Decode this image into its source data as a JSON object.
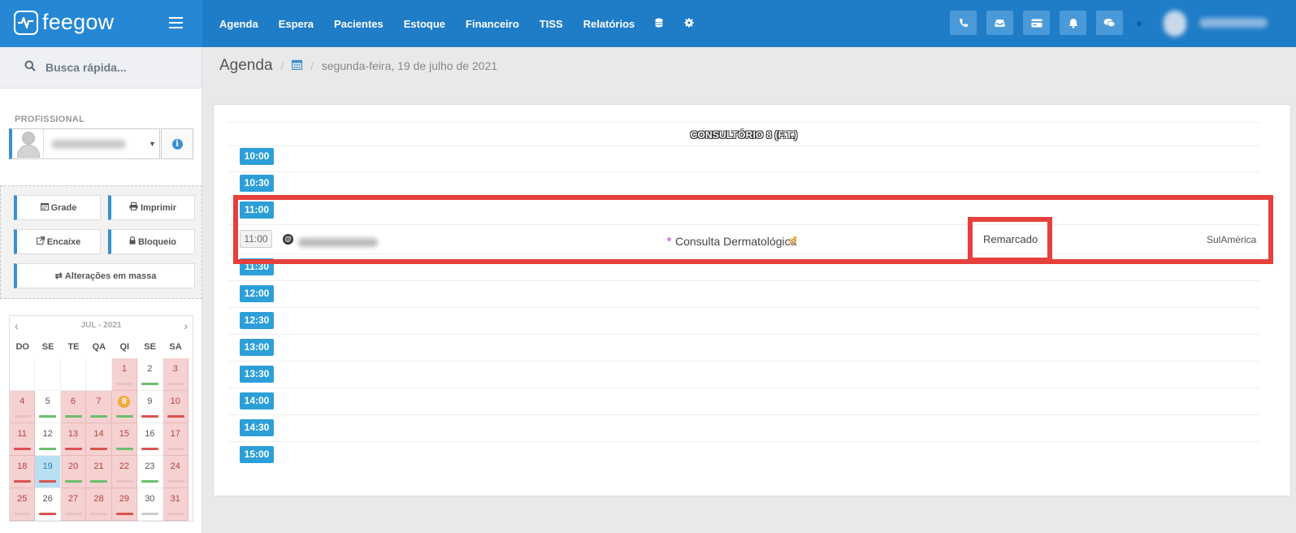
{
  "brand": {
    "name": "feegow"
  },
  "nav": {
    "items": [
      "Agenda",
      "Espera",
      "Pacientes",
      "Estoque",
      "Financeiro",
      "TISS",
      "Relatórios"
    ],
    "icon_items": [
      "database-icon",
      "gear-icon"
    ]
  },
  "toolbar": {
    "buttons": [
      "phone-icon",
      "inbox-icon",
      "credit-card-icon",
      "bell-icon",
      "chat-icon"
    ]
  },
  "sidebar": {
    "search_placeholder": "Busca rápida...",
    "profissional_label": "PROFISSIONAL",
    "actions": {
      "grade": "Grade",
      "imprimir": "Imprimir",
      "encaixe": "Encaixe",
      "bloqueio": "Bloqueio",
      "alteracoes": "Alterações em massa"
    }
  },
  "calendar": {
    "title": "JUL - 2021",
    "weekdays": [
      "DO",
      "SE",
      "TE",
      "QA",
      "QI",
      "SE",
      "SA"
    ],
    "selected_day": 19,
    "today_badge": 8,
    "days": [
      {
        "d": "",
        "s": "empty",
        "bar": ""
      },
      {
        "d": "",
        "s": "empty",
        "bar": ""
      },
      {
        "d": "",
        "s": "empty",
        "bar": ""
      },
      {
        "d": "",
        "s": "empty",
        "bar": ""
      },
      {
        "d": "1",
        "s": "red",
        "bar": "#e6c3c3"
      },
      {
        "d": "2",
        "s": "",
        "bar": "#6cbf6c"
      },
      {
        "d": "3",
        "s": "red",
        "bar": "#e6c3c3"
      },
      {
        "d": "4",
        "s": "red",
        "bar": "#e6c3c3"
      },
      {
        "d": "5",
        "s": "",
        "bar": "#6cbf6c"
      },
      {
        "d": "6",
        "s": "red",
        "bar": "#6cbf6c"
      },
      {
        "d": "7",
        "s": "red",
        "bar": "#6cbf6c"
      },
      {
        "d": "8",
        "s": "red",
        "bar": "#6cbf6c"
      },
      {
        "d": "9",
        "s": "",
        "bar": "#d9534f"
      },
      {
        "d": "10",
        "s": "red",
        "bar": "#d9534f"
      },
      {
        "d": "11",
        "s": "red",
        "bar": "#d9534f"
      },
      {
        "d": "12",
        "s": "",
        "bar": "#6cbf6c"
      },
      {
        "d": "13",
        "s": "red",
        "bar": "#d9534f"
      },
      {
        "d": "14",
        "s": "red",
        "bar": "#d9534f"
      },
      {
        "d": "15",
        "s": "red",
        "bar": "#6cbf6c"
      },
      {
        "d": "16",
        "s": "",
        "bar": "#d9534f"
      },
      {
        "d": "17",
        "s": "red",
        "bar": "#e6c3c3"
      },
      {
        "d": "18",
        "s": "red",
        "bar": "#d9534f"
      },
      {
        "d": "19",
        "s": "sel",
        "bar": "#d9534f"
      },
      {
        "d": "20",
        "s": "red",
        "bar": "#6cbf6c"
      },
      {
        "d": "21",
        "s": "red",
        "bar": "#6cbf6c"
      },
      {
        "d": "22",
        "s": "red",
        "bar": "#e6c3c3"
      },
      {
        "d": "23",
        "s": "",
        "bar": "#6cbf6c"
      },
      {
        "d": "24",
        "s": "red",
        "bar": "#e6c3c3"
      },
      {
        "d": "25",
        "s": "red",
        "bar": "#e6c3c3"
      },
      {
        "d": "26",
        "s": "",
        "bar": "#d9534f"
      },
      {
        "d": "27",
        "s": "red",
        "bar": "#e6c3c3"
      },
      {
        "d": "28",
        "s": "red",
        "bar": "#e6c3c3"
      },
      {
        "d": "29",
        "s": "red",
        "bar": "#d9534f"
      },
      {
        "d": "30",
        "s": "",
        "bar": "#cccccc"
      },
      {
        "d": "31",
        "s": "red",
        "bar": "#e6c3c3"
      }
    ]
  },
  "breadcrumb": {
    "title": "Agenda",
    "date": "segunda-feira, 19 de julho de 2021"
  },
  "schedule": {
    "column_title": "CONSULTÓRIO 8 (F.T.)",
    "slots": [
      "10:00",
      "10:30",
      "11:00",
      "11:30",
      "12:00",
      "12:30",
      "13:00",
      "13:30",
      "14:00",
      "14:30",
      "15:00"
    ],
    "appointment": {
      "time": "11:00",
      "procedure": "Consulta Dermatológica",
      "status": "Remarcado",
      "insurance": "SulAmérica"
    }
  },
  "colors": {
    "topbar": "#1f7cc7",
    "slot": "#2d9fd8",
    "highlight": "#e5403b"
  }
}
